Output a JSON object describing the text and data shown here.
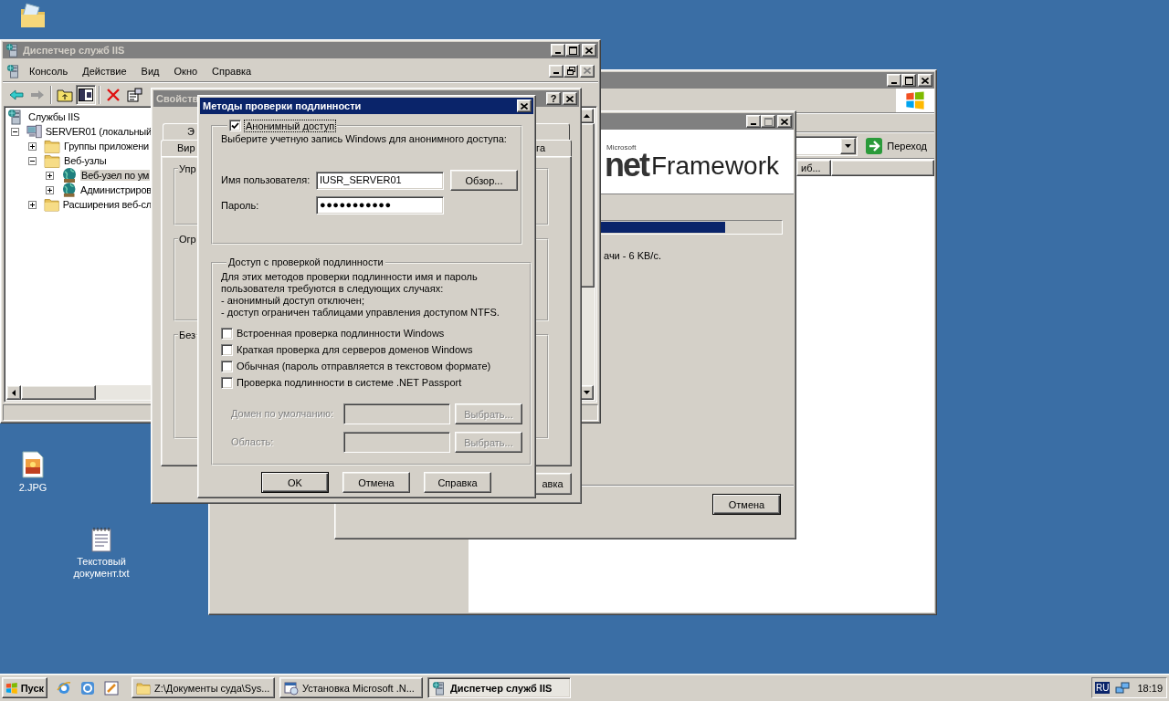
{
  "desktop": {
    "icons": [
      {
        "kind": "image",
        "label": "2.JPG"
      },
      {
        "kind": "text",
        "label": "Текстовый документ.txt"
      }
    ]
  },
  "browser_window": {
    "active": false,
    "go_button": "Переход",
    "column_header": "иб..."
  },
  "setup_window": {
    "active": false,
    "logo_brand": "Microsoft",
    "logo_mark": "net",
    "logo_name": "Framework",
    "progress": {
      "level": 0.87
    },
    "status": "ачи - 6 KB/с.",
    "cancel_button": "Отмена"
  },
  "iis_window": {
    "active": false,
    "title": "Диспетчер служб IIS",
    "menu": [
      "Консоль",
      "Действие",
      "Вид",
      "Окно",
      "Справка"
    ],
    "tree": [
      {
        "label": "Службы IIS",
        "kind": "services",
        "selected": false,
        "children": [
          {
            "label": "SERVER01 (локальный",
            "kind": "server",
            "expanded": true,
            "selected": false,
            "children": [
              {
                "label": "Группы приложени",
                "kind": "folder",
                "expanded": false,
                "selected": false
              },
              {
                "label": "Веб-узлы",
                "kind": "folder",
                "expanded": true,
                "selected": false,
                "children": [
                  {
                    "label": "Веб-узел по ум",
                    "kind": "site",
                    "expanded": false,
                    "selected": true
                  },
                  {
                    "label": "Администриров",
                    "kind": "site",
                    "expanded": false,
                    "selected": false
                  }
                ]
              },
              {
                "label": "Расширения веб-сл",
                "kind": "folder",
                "expanded": false,
                "selected": false
              }
            ]
          }
        ]
      }
    ]
  },
  "properties_dialog": {
    "active": false,
    "title": "Свойств",
    "help_button": "?",
    "tab_rows": [
      [
        "Э",
        ""
      ],
      [
        "Вир",
        "га"
      ]
    ],
    "groups": [
      "Упр",
      "Огр",
      "Без"
    ],
    "button": "авка"
  },
  "auth_dialog": {
    "active": true,
    "title": "Методы проверки подлинности",
    "anonymous": {
      "label": "Анонимный доступ",
      "checked": true,
      "focused": true
    },
    "anonymous_prompt": "Выберите учетную запись Windows для анонимного доступа:",
    "username": {
      "label": "Имя пользователя:",
      "value": "IUSR_SERVER01"
    },
    "browse_button": "Обзор...",
    "password": {
      "label": "Пароль:",
      "value": "●●●●●●●●●●●"
    },
    "auth_group": {
      "title": "Доступ с проверкой подлинности",
      "description": "Для этих методов проверки подлинности имя и пароль\nпользователя требуются в следующих случаях:\n- анонимный доступ отключен;\n- доступ ограничен таблицами управления доступом NTFS."
    },
    "methods": [
      {
        "label": "Встроенная проверка подлинности Windows",
        "checked": false
      },
      {
        "label": "Краткая проверка для серверов доменов Windows",
        "checked": false
      },
      {
        "label": "Обычная (пароль отправляется в текстовом формате)",
        "checked": false
      },
      {
        "label": "Проверка подлинности в системе .NET Passport",
        "checked": false
      }
    ],
    "fields": [
      {
        "label": "Домен по умолчанию:",
        "disabled": true,
        "button": "Выбрать..."
      },
      {
        "label": "Область:",
        "disabled": true,
        "button": "Выбрать..."
      }
    ],
    "buttons": [
      {
        "label": "OK",
        "default": true
      },
      {
        "label": "Отмена",
        "default": false
      },
      {
        "label": "Справка",
        "default": false
      }
    ]
  },
  "taskbar": {
    "start_button": "Пуск",
    "tasks": [
      {
        "label": "Z:\\Документы суда\\Sys...",
        "kind": "folder",
        "selected": false
      },
      {
        "label": "Установка Microsoft .N...",
        "kind": "setup",
        "selected": false
      },
      {
        "label": "Диспетчер служб IIS",
        "kind": "server",
        "selected": true
      }
    ],
    "language": "RU",
    "clock": "18:19"
  }
}
